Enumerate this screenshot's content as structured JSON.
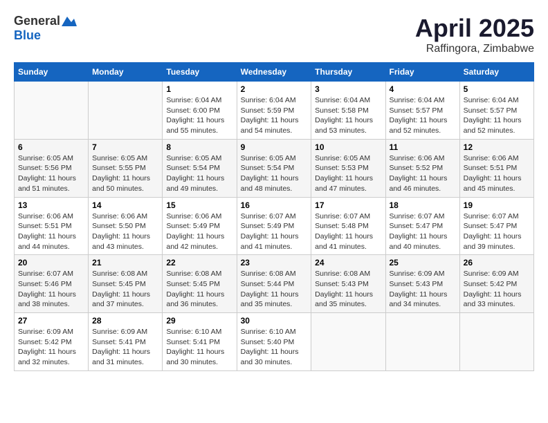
{
  "header": {
    "logo_general": "General",
    "logo_blue": "Blue",
    "title": "April 2025",
    "location": "Raffingora, Zimbabwe"
  },
  "columns": [
    "Sunday",
    "Monday",
    "Tuesday",
    "Wednesday",
    "Thursday",
    "Friday",
    "Saturday"
  ],
  "weeks": [
    [
      {
        "day": "",
        "sunrise": "",
        "sunset": "",
        "daylight": ""
      },
      {
        "day": "",
        "sunrise": "",
        "sunset": "",
        "daylight": ""
      },
      {
        "day": "1",
        "sunrise": "Sunrise: 6:04 AM",
        "sunset": "Sunset: 6:00 PM",
        "daylight": "Daylight: 11 hours and 55 minutes."
      },
      {
        "day": "2",
        "sunrise": "Sunrise: 6:04 AM",
        "sunset": "Sunset: 5:59 PM",
        "daylight": "Daylight: 11 hours and 54 minutes."
      },
      {
        "day": "3",
        "sunrise": "Sunrise: 6:04 AM",
        "sunset": "Sunset: 5:58 PM",
        "daylight": "Daylight: 11 hours and 53 minutes."
      },
      {
        "day": "4",
        "sunrise": "Sunrise: 6:04 AM",
        "sunset": "Sunset: 5:57 PM",
        "daylight": "Daylight: 11 hours and 52 minutes."
      },
      {
        "day": "5",
        "sunrise": "Sunrise: 6:04 AM",
        "sunset": "Sunset: 5:57 PM",
        "daylight": "Daylight: 11 hours and 52 minutes."
      }
    ],
    [
      {
        "day": "6",
        "sunrise": "Sunrise: 6:05 AM",
        "sunset": "Sunset: 5:56 PM",
        "daylight": "Daylight: 11 hours and 51 minutes."
      },
      {
        "day": "7",
        "sunrise": "Sunrise: 6:05 AM",
        "sunset": "Sunset: 5:55 PM",
        "daylight": "Daylight: 11 hours and 50 minutes."
      },
      {
        "day": "8",
        "sunrise": "Sunrise: 6:05 AM",
        "sunset": "Sunset: 5:54 PM",
        "daylight": "Daylight: 11 hours and 49 minutes."
      },
      {
        "day": "9",
        "sunrise": "Sunrise: 6:05 AM",
        "sunset": "Sunset: 5:54 PM",
        "daylight": "Daylight: 11 hours and 48 minutes."
      },
      {
        "day": "10",
        "sunrise": "Sunrise: 6:05 AM",
        "sunset": "Sunset: 5:53 PM",
        "daylight": "Daylight: 11 hours and 47 minutes."
      },
      {
        "day": "11",
        "sunrise": "Sunrise: 6:06 AM",
        "sunset": "Sunset: 5:52 PM",
        "daylight": "Daylight: 11 hours and 46 minutes."
      },
      {
        "day": "12",
        "sunrise": "Sunrise: 6:06 AM",
        "sunset": "Sunset: 5:51 PM",
        "daylight": "Daylight: 11 hours and 45 minutes."
      }
    ],
    [
      {
        "day": "13",
        "sunrise": "Sunrise: 6:06 AM",
        "sunset": "Sunset: 5:51 PM",
        "daylight": "Daylight: 11 hours and 44 minutes."
      },
      {
        "day": "14",
        "sunrise": "Sunrise: 6:06 AM",
        "sunset": "Sunset: 5:50 PM",
        "daylight": "Daylight: 11 hours and 43 minutes."
      },
      {
        "day": "15",
        "sunrise": "Sunrise: 6:06 AM",
        "sunset": "Sunset: 5:49 PM",
        "daylight": "Daylight: 11 hours and 42 minutes."
      },
      {
        "day": "16",
        "sunrise": "Sunrise: 6:07 AM",
        "sunset": "Sunset: 5:49 PM",
        "daylight": "Daylight: 11 hours and 41 minutes."
      },
      {
        "day": "17",
        "sunrise": "Sunrise: 6:07 AM",
        "sunset": "Sunset: 5:48 PM",
        "daylight": "Daylight: 11 hours and 41 minutes."
      },
      {
        "day": "18",
        "sunrise": "Sunrise: 6:07 AM",
        "sunset": "Sunset: 5:47 PM",
        "daylight": "Daylight: 11 hours and 40 minutes."
      },
      {
        "day": "19",
        "sunrise": "Sunrise: 6:07 AM",
        "sunset": "Sunset: 5:47 PM",
        "daylight": "Daylight: 11 hours and 39 minutes."
      }
    ],
    [
      {
        "day": "20",
        "sunrise": "Sunrise: 6:07 AM",
        "sunset": "Sunset: 5:46 PM",
        "daylight": "Daylight: 11 hours and 38 minutes."
      },
      {
        "day": "21",
        "sunrise": "Sunrise: 6:08 AM",
        "sunset": "Sunset: 5:45 PM",
        "daylight": "Daylight: 11 hours and 37 minutes."
      },
      {
        "day": "22",
        "sunrise": "Sunrise: 6:08 AM",
        "sunset": "Sunset: 5:45 PM",
        "daylight": "Daylight: 11 hours and 36 minutes."
      },
      {
        "day": "23",
        "sunrise": "Sunrise: 6:08 AM",
        "sunset": "Sunset: 5:44 PM",
        "daylight": "Daylight: 11 hours and 35 minutes."
      },
      {
        "day": "24",
        "sunrise": "Sunrise: 6:08 AM",
        "sunset": "Sunset: 5:43 PM",
        "daylight": "Daylight: 11 hours and 35 minutes."
      },
      {
        "day": "25",
        "sunrise": "Sunrise: 6:09 AM",
        "sunset": "Sunset: 5:43 PM",
        "daylight": "Daylight: 11 hours and 34 minutes."
      },
      {
        "day": "26",
        "sunrise": "Sunrise: 6:09 AM",
        "sunset": "Sunset: 5:42 PM",
        "daylight": "Daylight: 11 hours and 33 minutes."
      }
    ],
    [
      {
        "day": "27",
        "sunrise": "Sunrise: 6:09 AM",
        "sunset": "Sunset: 5:42 PM",
        "daylight": "Daylight: 11 hours and 32 minutes."
      },
      {
        "day": "28",
        "sunrise": "Sunrise: 6:09 AM",
        "sunset": "Sunset: 5:41 PM",
        "daylight": "Daylight: 11 hours and 31 minutes."
      },
      {
        "day": "29",
        "sunrise": "Sunrise: 6:10 AM",
        "sunset": "Sunset: 5:41 PM",
        "daylight": "Daylight: 11 hours and 30 minutes."
      },
      {
        "day": "30",
        "sunrise": "Sunrise: 6:10 AM",
        "sunset": "Sunset: 5:40 PM",
        "daylight": "Daylight: 11 hours and 30 minutes."
      },
      {
        "day": "",
        "sunrise": "",
        "sunset": "",
        "daylight": ""
      },
      {
        "day": "",
        "sunrise": "",
        "sunset": "",
        "daylight": ""
      },
      {
        "day": "",
        "sunrise": "",
        "sunset": "",
        "daylight": ""
      }
    ]
  ]
}
